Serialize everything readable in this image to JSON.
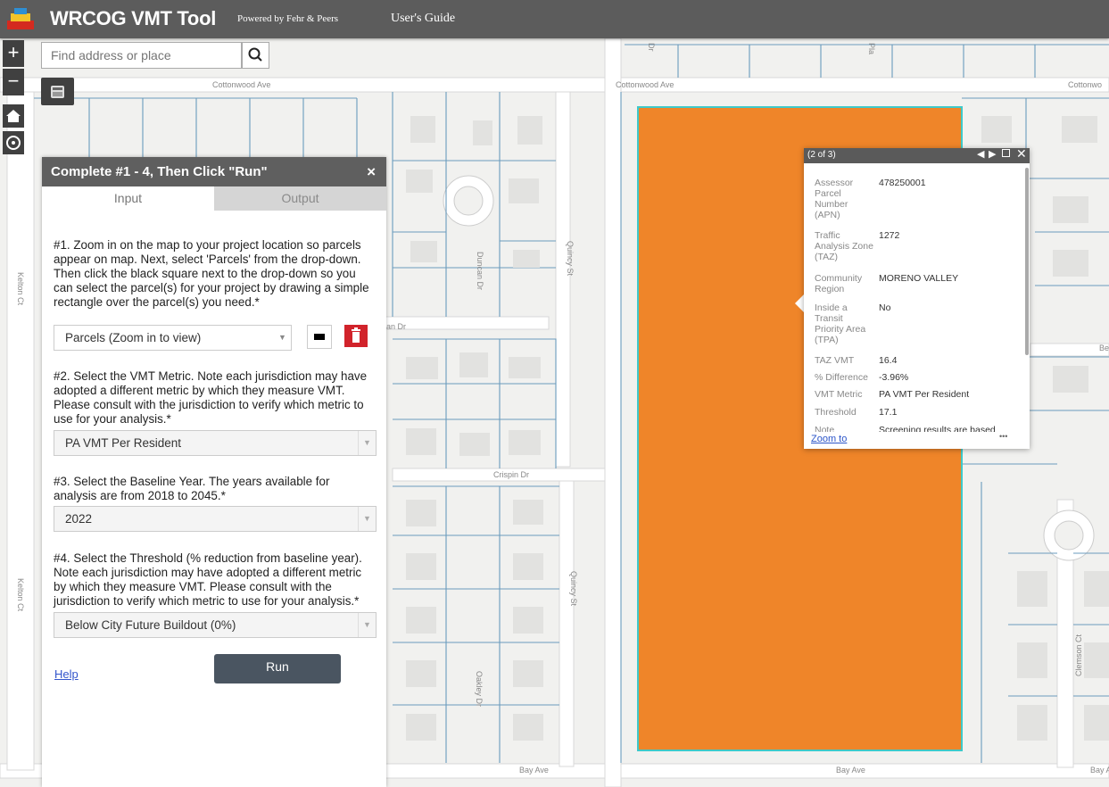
{
  "header": {
    "app_title": "WRCOG VMT Tool",
    "powered_by": "Powered by Fehr & Peers",
    "users_guide": "User's Guide"
  },
  "map_controls": {
    "zoom_in": "+",
    "zoom_out": "−",
    "search_placeholder": "Find address or place"
  },
  "map_labels": {
    "cottonwood_left": "Cottonwood Ave",
    "cottonwood_mid": "Cottonwood Ave",
    "cottonwood_right": "Cottonwo",
    "duncan": "Duncan Dr",
    "quincy_top": "Quincy St",
    "quincy_bottom": "Quincy St",
    "kelton_top": "Kelton Ct",
    "kelton_bottom": "Kelton Ct",
    "crispin": "Crispin Dr",
    "bay_mid": "Bay Ave",
    "bay_right": "Bay Ave",
    "bay_far": "Bay A",
    "oakley": "Oakley Dr",
    "clemson": "Clemson Ct",
    "duncan_dr_partial": "an Dr",
    "be_partial": "Be",
    "street_top_a": "Dr",
    "street_top_b": "Pla"
  },
  "panel": {
    "title": "Complete #1 - 4, Then Click \"Run\"",
    "close": "×",
    "tab_input": "Input",
    "tab_output": "Output",
    "step1": "#1. Zoom in on the map to your project location so parcels appear on map. Next, select 'Parcels' from the drop-down. Then click the black square next to the drop-down so you can select the parcel(s) for your project by drawing a simple rectangle over the parcel(s) you need.*",
    "parcels_select": "Parcels (Zoom in to view)",
    "step2": "#2. Select the VMT Metric. Note each jurisdiction may have adopted a different metric by which they measure VMT. Please consult with the jurisdiction to verify which metric to use for your analysis.*",
    "metric_select": "PA VMT Per Resident",
    "step3": "#3. Select the Baseline Year. The years available for analysis are from 2018 to 2045.*",
    "year_select": "2022",
    "step4": "#4. Select the Threshold (% reduction from baseline year). Note each jurisdiction may have adopted a different metric by which they measure VMT. Please consult with the jurisdiction to verify which metric to use for your analysis.*",
    "threshold_select": "Below City Future Buildout (0%)",
    "help": "Help",
    "run": "Run"
  },
  "popup": {
    "count": "(2 of 3)",
    "rows": [
      {
        "label": "Assessor Parcel Number (APN)",
        "value": "478250001"
      },
      {
        "label": "Traffic Analysis Zone (TAZ)",
        "value": "1272"
      },
      {
        "label": "Community Region",
        "value": "MORENO VALLEY"
      },
      {
        "label": "Inside a Transit Priority Area (TPA)",
        "value": "No"
      },
      {
        "label": "TAZ VMT",
        "value": "16.4"
      },
      {
        "label": "% Difference",
        "value": "-3.96%"
      },
      {
        "label": "VMT Metric",
        "value": "PA VMT Per Resident"
      },
      {
        "label": "Threshold",
        "value": "17.1"
      },
      {
        "label": "Note",
        "value": "Screening results are based"
      }
    ],
    "zoom_to": "Zoom to",
    "more": "•••"
  },
  "colors": {
    "parcel_fill": "#ef8529",
    "parcel_outline": "#3ec9c9",
    "parcel_lines": "#6a9bbd",
    "header_bg": "#5c5c5c",
    "run_button": "#4a5561",
    "delete_button": "#d1232b"
  }
}
